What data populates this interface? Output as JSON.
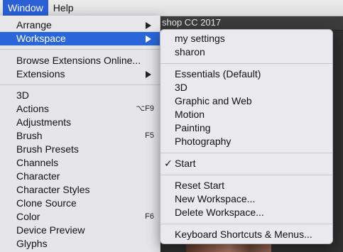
{
  "menubar": {
    "window_label": "Window",
    "help_label": "Help"
  },
  "app": {
    "title_fragment": "shop CC 2017"
  },
  "menu": {
    "arrange": "Arrange",
    "workspace": "Workspace",
    "browse_extensions": "Browse Extensions Online...",
    "extensions": "Extensions",
    "items": [
      {
        "label": "3D",
        "shortcut": ""
      },
      {
        "label": "Actions",
        "shortcut": "⌥F9"
      },
      {
        "label": "Adjustments",
        "shortcut": ""
      },
      {
        "label": "Brush",
        "shortcut": "F5"
      },
      {
        "label": "Brush Presets",
        "shortcut": ""
      },
      {
        "label": "Channels",
        "shortcut": ""
      },
      {
        "label": "Character",
        "shortcut": ""
      },
      {
        "label": "Character Styles",
        "shortcut": ""
      },
      {
        "label": "Clone Source",
        "shortcut": ""
      },
      {
        "label": "Color",
        "shortcut": "F6"
      },
      {
        "label": "Device Preview",
        "shortcut": ""
      },
      {
        "label": "Glyphs",
        "shortcut": ""
      }
    ]
  },
  "submenu": {
    "custom": [
      "my settings",
      "sharon"
    ],
    "presets": [
      "Essentials (Default)",
      "3D",
      "Graphic and Web",
      "Motion",
      "Painting",
      "Photography"
    ],
    "start": "Start",
    "start_checkmark": "✓",
    "manage": [
      "Reset Start",
      "New Workspace...",
      "Delete Workspace..."
    ],
    "keyboard_shortcuts": "Keyboard Shortcuts & Menus..."
  },
  "colors": {
    "highlight": "#2a66d9",
    "menubar_active": "#2a5fd6"
  }
}
